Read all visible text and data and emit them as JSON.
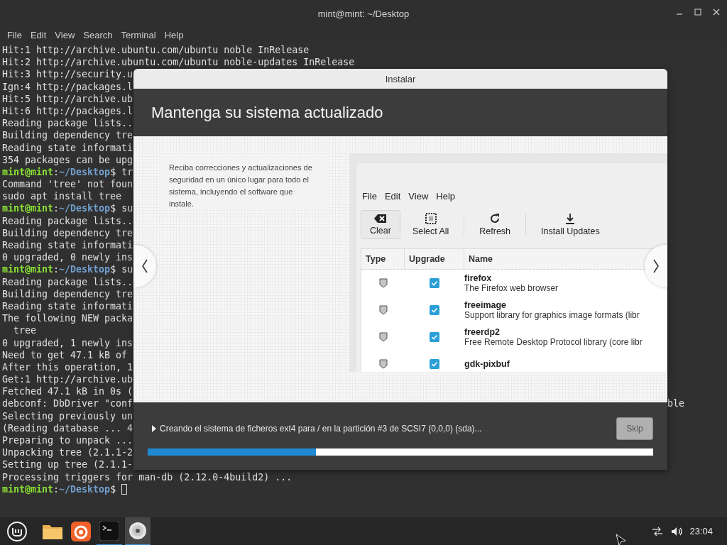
{
  "terminal": {
    "title": "mint@mint: ~/Desktop",
    "menu": [
      "File",
      "Edit",
      "View",
      "Search",
      "Terminal",
      "Help"
    ],
    "lines": [
      {
        "kind": "text",
        "text": "Hit:1 http://archive.ubuntu.com/ubuntu noble InRelease"
      },
      {
        "kind": "text",
        "text": "Hit:2 http://archive.ubuntu.com/ubuntu noble-updates InRelease"
      },
      {
        "kind": "text",
        "text": "Hit:3 http://security.u"
      },
      {
        "kind": "text",
        "text": "Ign:4 http://packages.l"
      },
      {
        "kind": "text",
        "text": "Hit:5 http://archive.ub"
      },
      {
        "kind": "text",
        "text": "Hit:6 http://packages.l"
      },
      {
        "kind": "text",
        "text": "Reading package lists.."
      },
      {
        "kind": "text",
        "text": "Building dependency tre"
      },
      {
        "kind": "text",
        "text": "Reading state informati"
      },
      {
        "kind": "text",
        "text": "354 packages can be upg"
      },
      {
        "kind": "prompt",
        "user": "mint@mint",
        "separator": ":",
        "path": "~/Desktop",
        "command": "$ tr",
        "cursor": false
      },
      {
        "kind": "text",
        "text": "Command 'tree' not foun"
      },
      {
        "kind": "text",
        "text": "sudo apt install tree"
      },
      {
        "kind": "prompt",
        "user": "mint@mint",
        "separator": ":",
        "path": "~/Desktop",
        "command": "$ su",
        "cursor": false
      },
      {
        "kind": "text",
        "text": "Reading package lists.."
      },
      {
        "kind": "text",
        "text": "Building dependency tre"
      },
      {
        "kind": "text",
        "text": "Reading state informati"
      },
      {
        "kind": "text",
        "text": "0 upgraded, 0 newly ins"
      },
      {
        "kind": "prompt",
        "user": "mint@mint",
        "separator": ":",
        "path": "~/Desktop",
        "command": "$ su",
        "cursor": false
      },
      {
        "kind": "text",
        "text": "Reading package lists.."
      },
      {
        "kind": "text",
        "text": "Building dependency tre"
      },
      {
        "kind": "text",
        "text": "Reading state informati"
      },
      {
        "kind": "text",
        "text": "The following NEW packa"
      },
      {
        "kind": "text",
        "text": "  tree"
      },
      {
        "kind": "text",
        "text": "0 upgraded, 1 newly ins"
      },
      {
        "kind": "text",
        "text": "Need to get 47.1 kB of"
      },
      {
        "kind": "text",
        "text": "After this operation, 1"
      },
      {
        "kind": "text",
        "text": "Get:1 http://archive.ub"
      },
      {
        "kind": "text",
        "text": "Fetched 47.1 kB in 0s ("
      },
      {
        "kind": "text",
        "text": "debconf: DbDriver \"conf",
        "tail": "ble"
      },
      {
        "kind": "text",
        "text": "Selecting previously un"
      },
      {
        "kind": "text",
        "text": "(Reading database ... 4"
      },
      {
        "kind": "text",
        "text": "Preparing to unpack ..."
      },
      {
        "kind": "text",
        "text": "Unpacking tree (2.1.1-2"
      },
      {
        "kind": "text",
        "text": "Setting up tree (2.1.1-"
      },
      {
        "kind": "text",
        "text": "Processing triggers for man-db (2.12.0-4build2) ..."
      },
      {
        "kind": "prompt",
        "user": "mint@mint",
        "separator": ":",
        "path": "~/Desktop",
        "command": "$ ",
        "cursor": true
      }
    ]
  },
  "installer": {
    "title": "Instalar",
    "heading": "Mantenga su sistema actualizado",
    "description": "Reciba correcciones y actualizaciones de seguridad en un único lugar para todo el sistema, incluyendo el software que instale.",
    "slide": {
      "menu": [
        "File",
        "Edit",
        "View",
        "Help"
      ],
      "toolbar": [
        {
          "kind": "clear",
          "label": "Clear",
          "pressed": true
        },
        {
          "kind": "select-all",
          "label": "Select All",
          "pressed": false
        },
        {
          "kind": "refresh",
          "label": "Refresh",
          "pressed": false
        },
        {
          "kind": "install",
          "label": "Install Updates",
          "pressed": false
        }
      ],
      "columns": [
        "Type",
        "Upgrade",
        "Name"
      ],
      "rows": [
        {
          "name": "firefox",
          "description": "The Firefox web browser",
          "upgrade": true
        },
        {
          "name": "freeimage",
          "description": "Support library for graphics image formats (libr",
          "upgrade": true
        },
        {
          "name": "freerdp2",
          "description": "Free Remote Desktop Protocol library (core libr",
          "upgrade": true
        },
        {
          "name": "gdk-pixbuf",
          "upgrade": true
        }
      ]
    },
    "status": "Creando el sistema de ficheros ext4 para / en la partición #3 de SCSI7 (0,0,0) (sda)...",
    "skip": {
      "label": "Skip",
      "disabled": true
    },
    "progress": {
      "level": 0.333
    }
  },
  "taskbar": {
    "apps": [
      {
        "kind": "files",
        "active": false
      },
      {
        "kind": "browser",
        "active": false
      },
      {
        "kind": "terminal",
        "active": true
      },
      {
        "kind": "disc",
        "active": true
      }
    ],
    "clock": "23:04"
  }
}
